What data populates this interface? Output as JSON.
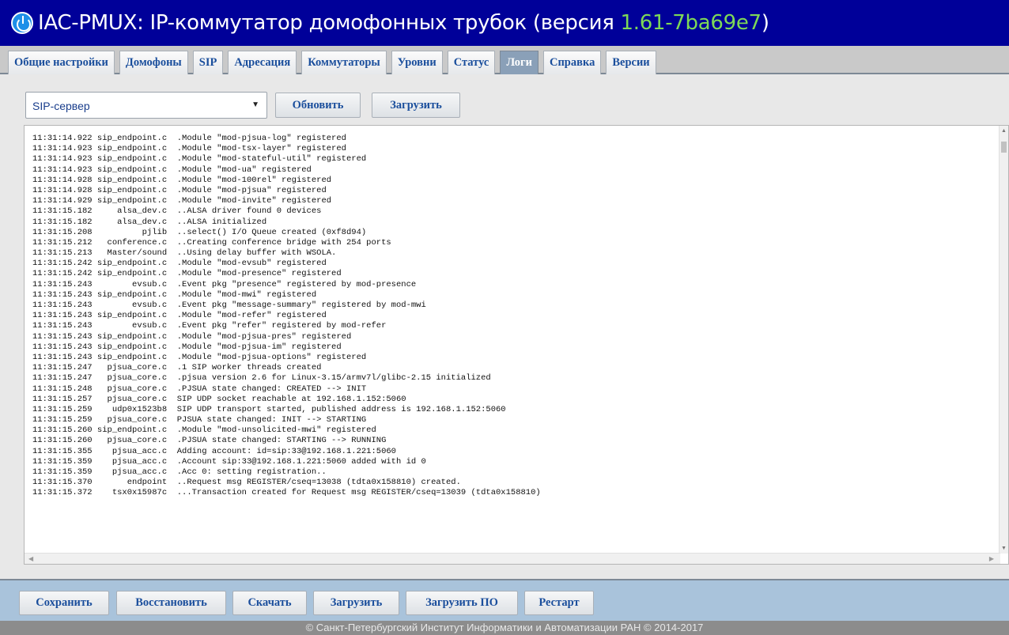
{
  "header": {
    "title_prefix": "IAC-PMUX: IP-коммутатор домофонных трубок (версия ",
    "version": "1.61-7ba69e7",
    "title_suffix": ")"
  },
  "tabs": [
    {
      "label": "Общие настройки",
      "active": false
    },
    {
      "label": "Домофоны",
      "active": false
    },
    {
      "label": "SIP",
      "active": false
    },
    {
      "label": "Адресация",
      "active": false
    },
    {
      "label": "Коммутаторы",
      "active": false
    },
    {
      "label": "Уровни",
      "active": false
    },
    {
      "label": "Статус",
      "active": false
    },
    {
      "label": "Логи",
      "active": true
    },
    {
      "label": "Справка",
      "active": false
    },
    {
      "label": "Версии",
      "active": false
    }
  ],
  "controls": {
    "log_source": "SIP-сервер",
    "refresh_label": "Обновить",
    "download_label": "Загрузить"
  },
  "log_lines": [
    "11:31:14.922 sip_endpoint.c  .Module \"mod-pjsua-log\" registered",
    "11:31:14.923 sip_endpoint.c  .Module \"mod-tsx-layer\" registered",
    "11:31:14.923 sip_endpoint.c  .Module \"mod-stateful-util\" registered",
    "11:31:14.923 sip_endpoint.c  .Module \"mod-ua\" registered",
    "11:31:14.928 sip_endpoint.c  .Module \"mod-100rel\" registered",
    "11:31:14.928 sip_endpoint.c  .Module \"mod-pjsua\" registered",
    "11:31:14.929 sip_endpoint.c  .Module \"mod-invite\" registered",
    "11:31:15.182     alsa_dev.c  ..ALSA driver found 0 devices",
    "11:31:15.182     alsa_dev.c  ..ALSA initialized",
    "11:31:15.208          pjlib  ..select() I/O Queue created (0xf8d94)",
    "11:31:15.212   conference.c  ..Creating conference bridge with 254 ports",
    "11:31:15.213   Master/sound  ..Using delay buffer with WSOLA.",
    "11:31:15.242 sip_endpoint.c  .Module \"mod-evsub\" registered",
    "11:31:15.242 sip_endpoint.c  .Module \"mod-presence\" registered",
    "11:31:15.243        evsub.c  .Event pkg \"presence\" registered by mod-presence",
    "11:31:15.243 sip_endpoint.c  .Module \"mod-mwi\" registered",
    "11:31:15.243        evsub.c  .Event pkg \"message-summary\" registered by mod-mwi",
    "11:31:15.243 sip_endpoint.c  .Module \"mod-refer\" registered",
    "11:31:15.243        evsub.c  .Event pkg \"refer\" registered by mod-refer",
    "11:31:15.243 sip_endpoint.c  .Module \"mod-pjsua-pres\" registered",
    "11:31:15.243 sip_endpoint.c  .Module \"mod-pjsua-im\" registered",
    "11:31:15.243 sip_endpoint.c  .Module \"mod-pjsua-options\" registered",
    "11:31:15.247   pjsua_core.c  .1 SIP worker threads created",
    "11:31:15.247   pjsua_core.c  .pjsua version 2.6 for Linux-3.15/armv7l/glibc-2.15 initialized",
    "11:31:15.248   pjsua_core.c  .PJSUA state changed: CREATED --> INIT",
    "11:31:15.257   pjsua_core.c  SIP UDP socket reachable at 192.168.1.152:5060",
    "11:31:15.259    udp0x1523b8  SIP UDP transport started, published address is 192.168.1.152:5060",
    "11:31:15.259   pjsua_core.c  PJSUA state changed: INIT --> STARTING",
    "11:31:15.260 sip_endpoint.c  .Module \"mod-unsolicited-mwi\" registered",
    "11:31:15.260   pjsua_core.c  .PJSUA state changed: STARTING --> RUNNING",
    "11:31:15.355    pjsua_acc.c  Adding account: id=sip:33@192.168.1.221:5060",
    "11:31:15.359    pjsua_acc.c  .Account sip:33@192.168.1.221:5060 added with id 0",
    "11:31:15.359    pjsua_acc.c  .Acc 0: setting registration..",
    "11:31:15.370       endpoint  ..Request msg REGISTER/cseq=13038 (tdta0x158810) created.",
    "11:31:15.372    tsx0x15987c  ...Transaction created for Request msg REGISTER/cseq=13039 (tdta0x158810)"
  ],
  "actions": {
    "save": "Сохранить",
    "restore": "Восстановить",
    "download": "Скачать",
    "upload": "Загрузить",
    "upload_firmware": "Загрузить ПО",
    "restart": "Рестарт"
  },
  "footer": {
    "text": "© Санкт-Петербургский Институт Информатики и Автоматизации РАН © 2014-2017"
  }
}
